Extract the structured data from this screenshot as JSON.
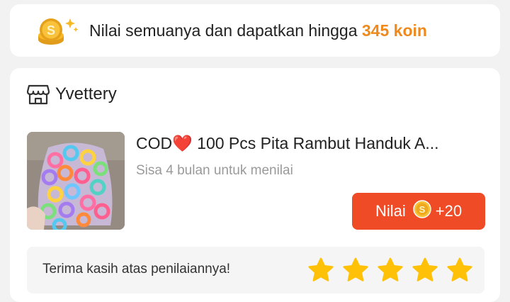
{
  "banner": {
    "text": "Nilai semuanya dan dapatkan hingga",
    "coins": "345 koin",
    "icon": "coin-stack-icon"
  },
  "shop": {
    "icon": "store-icon",
    "name": "Yvettery"
  },
  "product": {
    "title_prefix": "COD",
    "heart": "❤️",
    "title": " 100 Pcs Pita Rambut Handuk A...",
    "deadline": "Sisa 4 bulan untuk menilai",
    "thumbnail": "product-thumbnail-hair-ties"
  },
  "rate_button": {
    "label": "Nilai",
    "reward": "+20",
    "icon": "coin-icon"
  },
  "rating": {
    "thanks_text": "Terima kasih atas penilaiannya!",
    "stars": 5,
    "max_stars": 5
  },
  "colors": {
    "accent": "#ef4b27",
    "coin_text": "#ee8a1d",
    "star": "#ffc107",
    "background": "#f2f2f2"
  }
}
